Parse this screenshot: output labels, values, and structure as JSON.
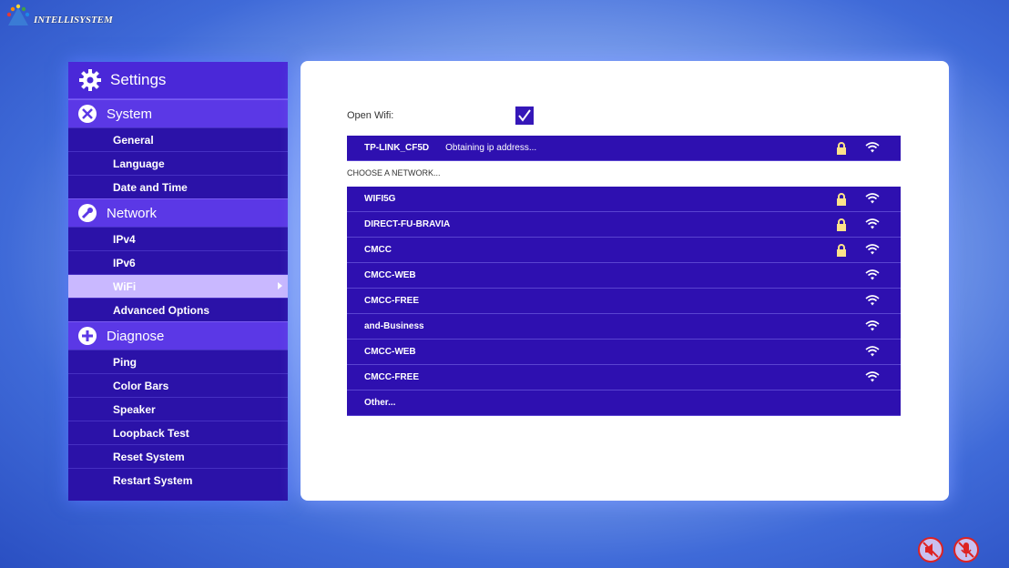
{
  "logo": {
    "text": "INTELLISYSTEM"
  },
  "sidebar": {
    "title": "Settings",
    "sections": [
      {
        "label": "System",
        "icon": "tools-icon",
        "items": [
          "General",
          "Language",
          "Date and Time"
        ]
      },
      {
        "label": "Network",
        "icon": "wrench-icon",
        "items": [
          "IPv4",
          "IPv6",
          "WiFi",
          "Advanced Options"
        ]
      },
      {
        "label": "Diagnose",
        "icon": "plus-circle-icon",
        "items": [
          "Ping",
          "Color Bars",
          "Speaker",
          "Loopback Test",
          "Reset System",
          "Restart System"
        ]
      }
    ],
    "active_item": "WiFi"
  },
  "wifi": {
    "open_wifi_label": "Open Wifi:",
    "open_wifi_checked": true,
    "connected": {
      "ssid": "TP-LINK_CF5D",
      "status": "Obtaining ip address...",
      "locked": true
    },
    "choose_label": "CHOOSE A NETWORK...",
    "networks": [
      {
        "ssid": "WIFI5G",
        "locked": true
      },
      {
        "ssid": "DIRECT-FU-BRAVIA",
        "locked": true
      },
      {
        "ssid": "CMCC",
        "locked": true
      },
      {
        "ssid": "CMCC-WEB",
        "locked": false
      },
      {
        "ssid": "CMCC-FREE",
        "locked": false
      },
      {
        "ssid": "and-Business",
        "locked": false
      },
      {
        "ssid": "CMCC-WEB",
        "locked": false
      },
      {
        "ssid": "CMCC-FREE",
        "locked": false
      }
    ],
    "other_label": "Other..."
  },
  "colors": {
    "panel_row": "#2e10b0",
    "accent": "#5b38e6",
    "active_item": "#c9b8ff"
  }
}
